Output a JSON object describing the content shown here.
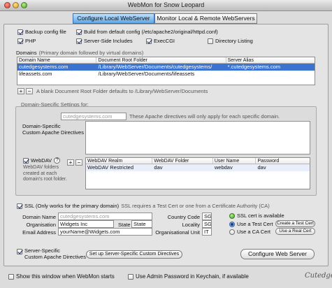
{
  "window": {
    "title": "WebMon for Snow Leopard"
  },
  "tabs": [
    {
      "label": "Configure Local WebServer",
      "active": true
    },
    {
      "label": "Monitor Local & Remote WebServers",
      "active": false
    }
  ],
  "options": {
    "backup_config": {
      "label": "Backup config file",
      "checked": true
    },
    "build_default": {
      "label": "Build from default config (/etc/apache2/original/httpd.conf)",
      "checked": true
    },
    "php": {
      "label": "PHP",
      "checked": true
    },
    "ssi": {
      "label": "Server-Side Includes",
      "checked": true
    },
    "execcgi": {
      "label": "ExecCGI",
      "checked": true
    },
    "dir_listing": {
      "label": "Directory Listing",
      "checked": false
    }
  },
  "domains": {
    "heading": "Domains",
    "heading_note": "(Primary domain followed by virtual domains)",
    "columns": [
      "Domain Name",
      "Document Root Folder",
      "Server Alias"
    ],
    "rows": [
      {
        "domain": "cutedgesystems.com",
        "root": "/Library/WebServer/Documents/cutedgesystems/",
        "alias": "*.cutedgesystems.com",
        "selected": true
      },
      {
        "domain": "lifeassets.com",
        "root": "/Library/WebServer/Documents/lifeassets",
        "alias": "",
        "selected": false
      }
    ],
    "add": "+",
    "remove": "−",
    "note": "A blank Document Root Folder defaults to /Library/WebServer/Documents"
  },
  "domain_specific": {
    "heading": "Domain-Specific Settings for:",
    "domain_placeholder": "cutedgesystems.com",
    "note": "These Apache directives will only apply for each specific domain.",
    "custom_label_1": "Domain-Specific",
    "custom_label_2": "Custom Apache Directives",
    "custom_text": ""
  },
  "webdav": {
    "label": "WebDAV",
    "checked": true,
    "help": "?",
    "desc": [
      "WebDAV folders",
      "created at each",
      "domain's root folder."
    ],
    "add": "+",
    "remove": "−",
    "columns": [
      "WebDAV Realm",
      "WebDAV Folder",
      "User Name",
      "Password"
    ],
    "rows": [
      {
        "realm": "WebDAV Restricted",
        "folder": "dav",
        "user": "webdav",
        "password": "dav"
      }
    ]
  },
  "ssl": {
    "label": "SSL (Only works for the primary domain)",
    "checked": true,
    "note": "SSL requires a Test Cert or one from a Certificate Authority (CA)",
    "domain_name_label": "Domain Name",
    "domain_name_placeholder": "cutedgesystems.com",
    "organisation_label": "Organisation",
    "organisation_value": "Widgets Inc",
    "state_label": "State",
    "state_value": "State",
    "email_label": "Email Address",
    "email_value": "yourName@Widgets.com",
    "country_label": "Country Code",
    "country_value": "SG",
    "locality_label": "Locality",
    "locality_value": "SG",
    "org_unit_label": "Organisational Unit",
    "org_unit_value": "IT",
    "cert_available": "SSL cert is available",
    "use_test_cert": "Use a Test Cert",
    "use_ca_cert": "Use a CA Cert",
    "create_test_cert": "Create a Test Cert",
    "use_real_cert": "Use a Real Cert",
    "selected_cert": "test"
  },
  "server_specific": {
    "label_1": "Server-Specific",
    "label_2": "Custom Apache Directives",
    "checked": true,
    "setup_button": "Set up Server-Specific Custom Directives",
    "configure_button": "Configure Web Server"
  },
  "footer": {
    "show_window": {
      "label": "Show this window when WebMon starts",
      "checked": false
    },
    "admin_password": {
      "label": "Use Admin Password in Keychain, if available",
      "checked": false
    },
    "brand": "Cutedge"
  }
}
